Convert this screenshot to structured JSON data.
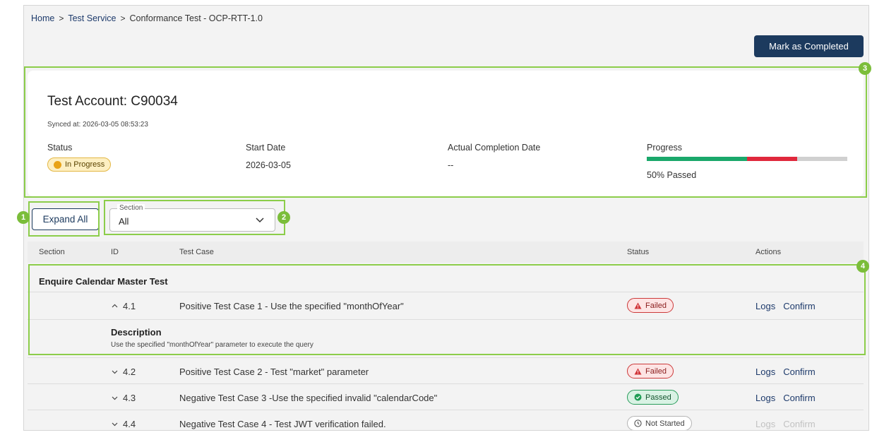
{
  "breadcrumb": {
    "home": "Home",
    "sep": ">",
    "service": "Test Service",
    "current": "Conformance Test - OCP-RTT-1.0"
  },
  "header": {
    "mark_completed": "Mark as Completed"
  },
  "account": {
    "title": "Test Account: C90034",
    "synced": "Synced at: 2026-03-05 08:53:23",
    "status_label": "Status",
    "status_value": "In Progress",
    "start_label": "Start Date",
    "start_value": "2026-03-05",
    "completion_label": "Actual Completion Date",
    "completion_value": "--",
    "progress_label": "Progress",
    "progress_text": "50% Passed",
    "progress": {
      "passed": 0.5,
      "failed": 0.25,
      "remaining": 0.25
    }
  },
  "controls": {
    "expand_all": "Expand All",
    "section_legend": "Section",
    "section_value": "All"
  },
  "table": {
    "columns": [
      "Section",
      "ID",
      "Test Case",
      "Status",
      "Actions"
    ],
    "section_name": "Enquire Calendar Master Test",
    "rows": [
      {
        "id": "4.1",
        "expanded": true,
        "name": "Positive Test Case 1 - Use the specified \"monthOfYear\"",
        "status": "Failed",
        "logs": "Logs",
        "confirm": "Confirm"
      },
      {
        "id": "4.2",
        "expanded": false,
        "name": "Positive Test Case 2 - Test \"market\" parameter",
        "status": "Failed",
        "logs": "Logs",
        "confirm": "Confirm"
      },
      {
        "id": "4.3",
        "expanded": false,
        "name": "Negative Test Case 3 -Use the specified invalid \"calendarCode\"",
        "status": "Passed",
        "logs": "Logs",
        "confirm": "Confirm"
      },
      {
        "id": "4.4",
        "expanded": false,
        "name": "Negative Test Case 4 - Test JWT verification failed.",
        "status": "Not Started",
        "logs": "Logs",
        "confirm": "Confirm"
      }
    ],
    "description": {
      "title": "Description",
      "text": "Use the specified \"monthOfYear\" parameter to execute the query"
    }
  },
  "callouts": [
    "1",
    "2",
    "3",
    "4"
  ],
  "colors": {
    "primary": "#1c3a5e",
    "passed": "#1aa86b",
    "failed": "#e0283c",
    "remaining": "#d0d0d0",
    "callout": "#7bbd3a"
  }
}
